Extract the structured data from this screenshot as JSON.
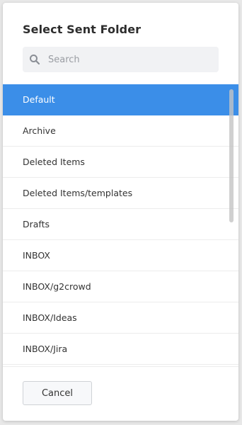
{
  "dialog": {
    "title": "Select Sent Folder",
    "search": {
      "placeholder": "Search",
      "value": ""
    },
    "folders": [
      {
        "label": "Default",
        "selected": true
      },
      {
        "label": "Archive",
        "selected": false
      },
      {
        "label": "Deleted Items",
        "selected": false
      },
      {
        "label": "Deleted Items/templates",
        "selected": false
      },
      {
        "label": "Drafts",
        "selected": false
      },
      {
        "label": "INBOX",
        "selected": false
      },
      {
        "label": "INBOX/g2crowd",
        "selected": false
      },
      {
        "label": "INBOX/Ideas",
        "selected": false
      },
      {
        "label": "INBOX/Jira",
        "selected": false
      }
    ],
    "cancel_label": "Cancel"
  },
  "icons": {
    "search": "search-icon"
  },
  "colors": {
    "selected_background": "#3b8ee8",
    "selected_text": "#ffffff",
    "text": "#333333",
    "search_background": "#f1f2f4"
  }
}
